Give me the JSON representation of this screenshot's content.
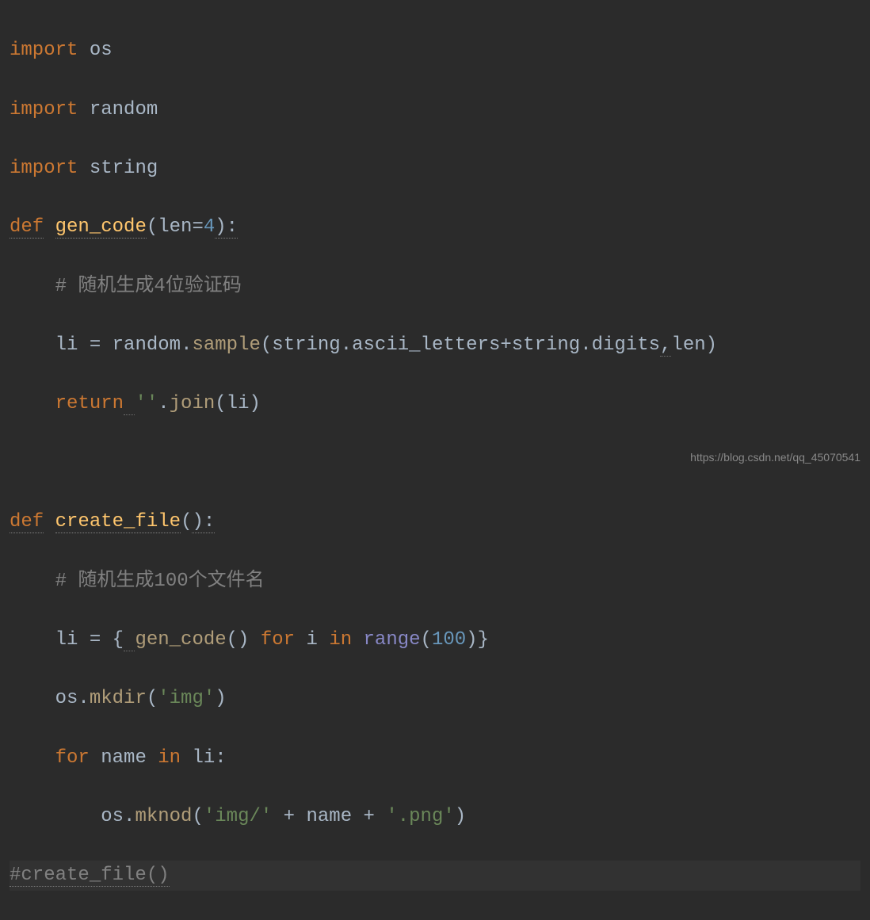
{
  "code": {
    "line1": {
      "kw": "import",
      "mod": "os"
    },
    "line2": {
      "kw": "import",
      "mod": "random"
    },
    "line3": {
      "kw": "import",
      "mod": "string"
    },
    "line4": {
      "kw": "def",
      "fn": "gen_code",
      "lp": "(",
      "param": "len",
      "eq": "=",
      "num": "4",
      "rp": "):"
    },
    "line5": {
      "indent": "    ",
      "comment": "# 随机生成4位验证码"
    },
    "line6": {
      "indent": "    ",
      "var": "li",
      "assign": " = ",
      "mod": "random",
      "dot": ".",
      "method": "sample",
      "lp": "(",
      "mod2": "string",
      "dot2": ".",
      "attr": "ascii_letters",
      "plus": "+",
      "mod3": "string",
      "dot3": ".",
      "attr2": "digits",
      "comma": ",",
      "arg": "len",
      "rp": ")"
    },
    "line7": {
      "indent": "    ",
      "kw": "return",
      "space": " ",
      "str": "''",
      "dot": ".",
      "method": "join",
      "lp": "(",
      "arg": "li",
      "rp": ")"
    },
    "line8": "",
    "line9": {
      "kw": "def",
      "fn": "create_file",
      "lp": "(",
      "rp": "):"
    },
    "line10": {
      "indent": "    ",
      "comment": "# 随机生成100个文件名"
    },
    "line11": {
      "indent": "    ",
      "var": "li",
      "assign": " = {",
      "fn": "gen_code",
      "call": "() ",
      "kw1": "for",
      "sp1": " ",
      "var2": "i",
      "sp2": " ",
      "kw2": "in",
      "sp3": " ",
      "builtin": "range",
      "lp": "(",
      "num": "100",
      "rp": ")}"
    },
    "line12": {
      "indent": "    ",
      "mod": "os",
      "dot": ".",
      "method": "mkdir",
      "lp": "(",
      "str": "'img'",
      "rp": ")"
    },
    "line13": {
      "indent": "    ",
      "kw1": "for",
      "sp1": " ",
      "var": "name",
      "sp2": " ",
      "kw2": "in",
      "sp3": " ",
      "var2": "li",
      "colon": ":"
    },
    "line14": {
      "indent": "        ",
      "mod": "os",
      "dot": ".",
      "method": "mknod",
      "lp": "(",
      "str1": "'img/'",
      "plus1": " + ",
      "var": "name",
      "plus2": " + ",
      "str2": "'.png'",
      "rp": ")"
    },
    "line15": {
      "comment": "#create_file()"
    }
  },
  "watermark": "https://blog.csdn.net/qq_45070541"
}
